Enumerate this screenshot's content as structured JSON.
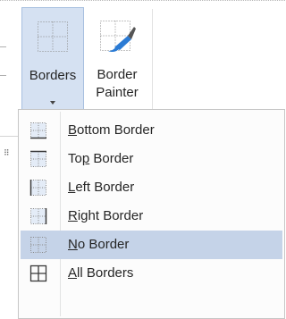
{
  "ribbon": {
    "borders_button": {
      "line1": "Borders",
      "icon": "borders-grid-icon"
    },
    "border_painter_button": {
      "line1": "Border",
      "line2": "Painter",
      "icon": "border-painter-icon"
    }
  },
  "menu": {
    "items": [
      {
        "pre": "",
        "mnemonic": "B",
        "post": "ottom Border",
        "icon": "bottom-border-icon",
        "highlighted": false
      },
      {
        "pre": "To",
        "mnemonic": "p",
        "post": " Border",
        "icon": "top-border-icon",
        "highlighted": false
      },
      {
        "pre": "",
        "mnemonic": "L",
        "post": "eft Border",
        "icon": "left-border-icon",
        "highlighted": false
      },
      {
        "pre": "",
        "mnemonic": "R",
        "post": "ight Border",
        "icon": "right-border-icon",
        "highlighted": false
      },
      {
        "pre": "",
        "mnemonic": "N",
        "post": "o Border",
        "icon": "no-border-icon",
        "highlighted": true
      },
      {
        "pre": "",
        "mnemonic": "A",
        "post": "ll Borders",
        "icon": "all-borders-icon",
        "highlighted": false
      }
    ]
  },
  "colors": {
    "highlight": "#c5d3e8",
    "selected_button": "#d5e1f2",
    "menu_background": "#fcfcfc"
  }
}
